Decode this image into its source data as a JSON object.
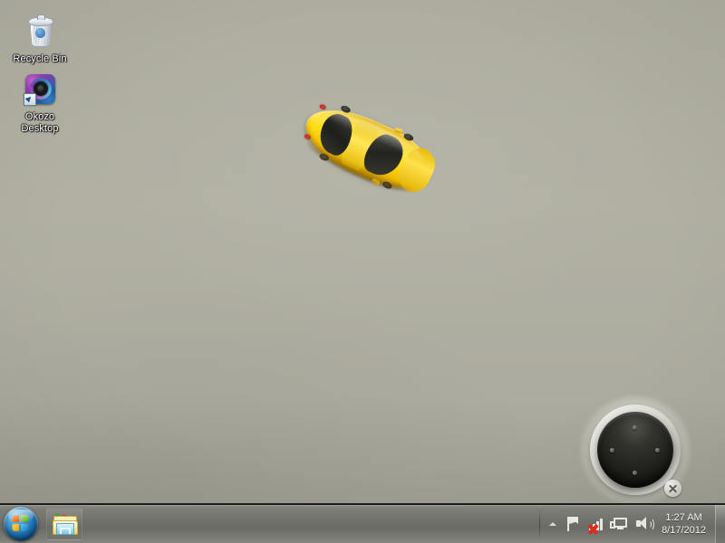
{
  "desktop": {
    "wallpaper_color": "#aeada0",
    "icons": [
      {
        "name": "recycle-bin",
        "label": "Recycle Bin",
        "icon": "recycle-bin-icon"
      },
      {
        "name": "okozo-desktop",
        "label": "Okozo\nDesktop",
        "label_line1": "Okozo",
        "label_line2": "Desktop",
        "icon": "okozo-desktop-icon"
      }
    ]
  },
  "widgets": {
    "car": {
      "name": "okozo-car-widget",
      "color": "#ffd712",
      "description": "yellow sports car top view"
    },
    "dial": {
      "name": "okozo-dial-widget",
      "close_label": "×",
      "dots": [
        "up",
        "down",
        "left",
        "right"
      ]
    }
  },
  "taskbar": {
    "start_button": {
      "name": "start-orb",
      "label": "Start"
    },
    "pinned": [
      {
        "name": "windows-explorer",
        "label": "Windows Explorer",
        "icon": "folder-icon"
      }
    ],
    "tray": {
      "expand": {
        "name": "show-hidden-icons",
        "label": "Show hidden icons",
        "icon": "chevron-up-icon"
      },
      "icons": [
        {
          "name": "action-center",
          "label": "Action Center",
          "icon": "flag-icon"
        },
        {
          "name": "network-unavailable",
          "label": "No Internet access",
          "icon": "network-error-icon"
        },
        {
          "name": "network-connection",
          "label": "Network",
          "icon": "monitor-network-icon"
        },
        {
          "name": "volume",
          "label": "Volume",
          "icon": "speaker-icon"
        }
      ],
      "clock": {
        "time": "1:27 AM",
        "date": "8/17/2012"
      },
      "show_desktop": {
        "name": "show-desktop-button",
        "label": "Show desktop"
      }
    }
  }
}
